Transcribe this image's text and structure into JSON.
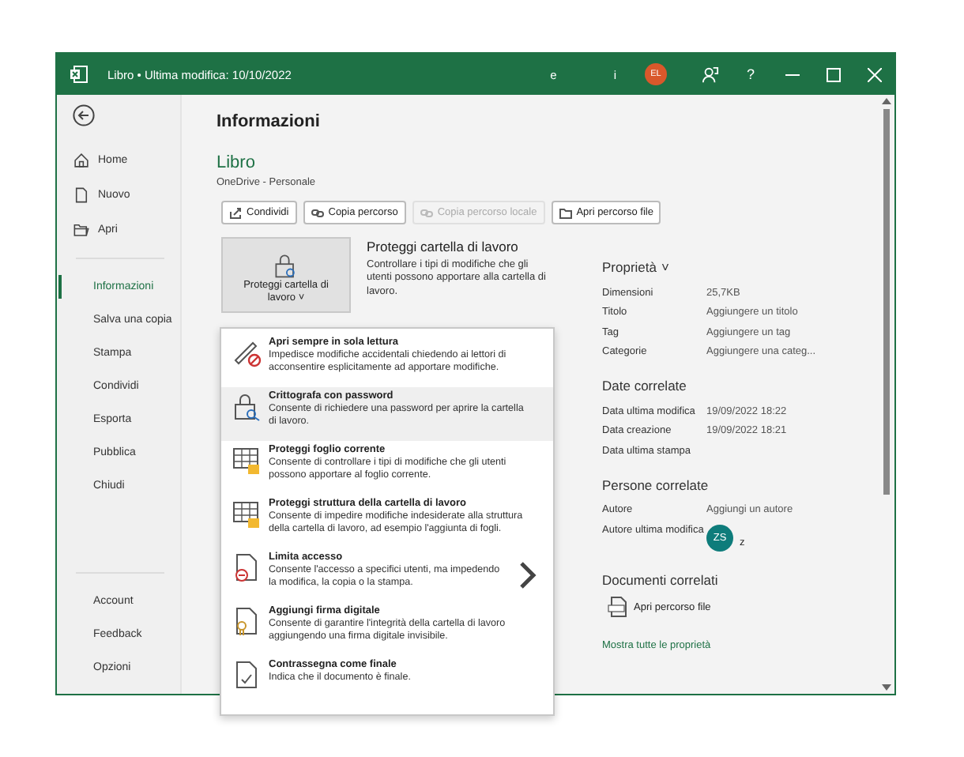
{
  "window": {
    "title": "Libro • Ultima modifica: 10/10/2022",
    "title_fragments": [
      "e",
      "i"
    ],
    "avatar": "EL",
    "help": "?"
  },
  "sidebar": {
    "top": [
      {
        "label": "Home",
        "selected": false
      },
      {
        "label": "Nuovo",
        "selected": false
      },
      {
        "label": "Apri",
        "selected": false
      }
    ],
    "middle": [
      {
        "label": "Informazioni",
        "selected": true
      },
      {
        "label": "Salva una copia",
        "selected": false
      },
      {
        "label": "Stampa",
        "selected": false
      },
      {
        "label": "Condividi",
        "selected": false
      },
      {
        "label": "Esporta",
        "selected": false
      },
      {
        "label": "Pubblica",
        "selected": false
      },
      {
        "label": "Chiudi",
        "selected": false
      }
    ],
    "bottom": [
      {
        "label": "Account",
        "selected": false
      },
      {
        "label": "Feedback",
        "selected": false
      },
      {
        "label": "Opzioni",
        "selected": false
      }
    ]
  },
  "page_title": "Informazioni",
  "file": {
    "name": "Libro",
    "location": "OneDrive - Personale"
  },
  "buttons": [
    {
      "label": "Condividi",
      "disabled": false
    },
    {
      "label": "Copia percorso",
      "disabled": false
    },
    {
      "label": "Copia percorso locale",
      "disabled": true
    },
    {
      "label": "Apri percorso file",
      "disabled": false
    }
  ],
  "protect": {
    "button": "Proteggi cartella di lavoro",
    "caret": "˅",
    "title": "Proteggi cartella di lavoro",
    "description": "Controllare i tipi di modifiche che gli utenti possono apportare alla cartella di lavoro."
  },
  "menu": [
    {
      "title": "Apri sempre in sola lettura",
      "description": "Impedisce modifiche accidentali chiedendo ai lettori di acconsentire esplicitamente ad apportare modifiche.",
      "selected": false,
      "submenu": false
    },
    {
      "title": "Crittografa con password",
      "description": "Consente di richiedere una password per aprire la cartella di lavoro.",
      "selected": true,
      "submenu": false
    },
    {
      "title": "Proteggi foglio corrente",
      "description": "Consente di controllare i tipi di modifiche che gli utenti possono apportare al foglio corrente.",
      "selected": false,
      "submenu": false
    },
    {
      "title": "Proteggi struttura della cartella di lavoro",
      "description": "Consente di impedire modifiche indesiderate alla struttura della cartella di lavoro, ad esempio l'aggiunta di fogli.",
      "selected": false,
      "submenu": false
    },
    {
      "title": "Limita accesso",
      "description": "Consente l'accesso a specifici utenti, ma impedendo la modifica, la copia o la stampa.",
      "selected": false,
      "submenu": true
    },
    {
      "title": "Aggiungi firma digitale",
      "description": "Consente di garantire l'integrità della cartella di lavoro aggiungendo una firma digitale invisibile.",
      "selected": false,
      "submenu": false
    },
    {
      "title": "Contrassegna come finale",
      "description": "Indica che il documento è finale.",
      "selected": false,
      "submenu": false
    }
  ],
  "properties": {
    "heading": "Proprietà",
    "caret": "˅",
    "rows": [
      {
        "label": "Dimensioni",
        "value": "25,7KB"
      },
      {
        "label": "Titolo",
        "value": "Aggiungere un titolo"
      },
      {
        "label": "Tag",
        "value": "Aggiungere un tag"
      },
      {
        "label": "Categorie",
        "value": "Aggiungere una categ..."
      }
    ]
  },
  "dates": {
    "heading": "Date correlate",
    "rows": [
      {
        "label": "Data ultima modifica",
        "value": "19/09/2022 18:22"
      },
      {
        "label": "Data creazione",
        "value": "19/09/2022 18:21"
      },
      {
        "label": "Data ultima stampa",
        "value": ""
      }
    ]
  },
  "people": {
    "heading": "Persone correlate",
    "author_label": "Autore",
    "author_value": "Aggiungi un autore",
    "last_label": "Autore ultima modifica",
    "last_initials": "ZS",
    "last_name": "z"
  },
  "documents": {
    "heading": "Documenti correlati",
    "open_path": "Apri percorso file",
    "show_all": "Mostra tutte le proprietà"
  }
}
